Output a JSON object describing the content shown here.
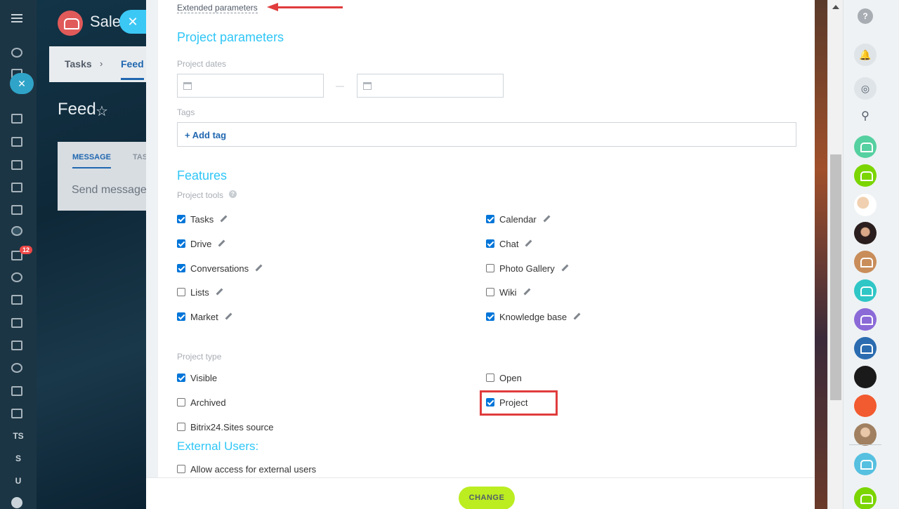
{
  "background": {
    "app_title": "Sale",
    "breadcrumb": {
      "tasks": "Tasks",
      "feed": "Feed"
    },
    "page_title": "Feed",
    "composer": {
      "tab_message": "MESSAGE",
      "tab_tasks": "TAS",
      "placeholder": "Send message"
    },
    "notifications_badge": "12"
  },
  "left_nav": {
    "items": [
      "TS",
      "S",
      "U"
    ]
  },
  "form": {
    "extended_link": "Extended parameters",
    "project_parameters_title": "Project parameters",
    "project_dates_label": "Project dates",
    "date_separator": "—",
    "tags_label": "Tags",
    "add_tag_label": "+ Add tag",
    "features_title": "Features",
    "project_tools_label": "Project tools",
    "tools": [
      {
        "label": "Tasks",
        "checked": true
      },
      {
        "label": "Drive",
        "checked": true
      },
      {
        "label": "Conversations",
        "checked": true
      },
      {
        "label": "Lists",
        "checked": false
      },
      {
        "label": "Market",
        "checked": true
      },
      {
        "label": "Calendar",
        "checked": true
      },
      {
        "label": "Chat",
        "checked": true
      },
      {
        "label": "Photo Gallery",
        "checked": false
      },
      {
        "label": "Wiki",
        "checked": false
      },
      {
        "label": "Knowledge base",
        "checked": true
      }
    ],
    "project_type_label": "Project type",
    "types": [
      {
        "label": "Visible",
        "checked": true
      },
      {
        "label": "Archived",
        "checked": false
      },
      {
        "label": "Bitrix24.Sites source",
        "checked": false
      },
      {
        "label": "Open",
        "checked": false
      },
      {
        "label": "Project",
        "checked": true
      }
    ],
    "external_users_title": "External Users:",
    "allow_external_label": "Allow access for external users",
    "allow_external_checked": false,
    "submit_label": "CHANGE"
  },
  "right_bar": {
    "help": "?",
    "avatar_colors": [
      "#55d0a0",
      "#7bd500",
      "#c98d5a",
      "#2fc6c6",
      "#8b6ad8",
      "#2b6cb0",
      "#f25a2f"
    ]
  },
  "colors": {
    "accent": "#2fc6f6",
    "link": "#2067b0",
    "button": "#bbed21",
    "highlight": "#e03c3c"
  }
}
